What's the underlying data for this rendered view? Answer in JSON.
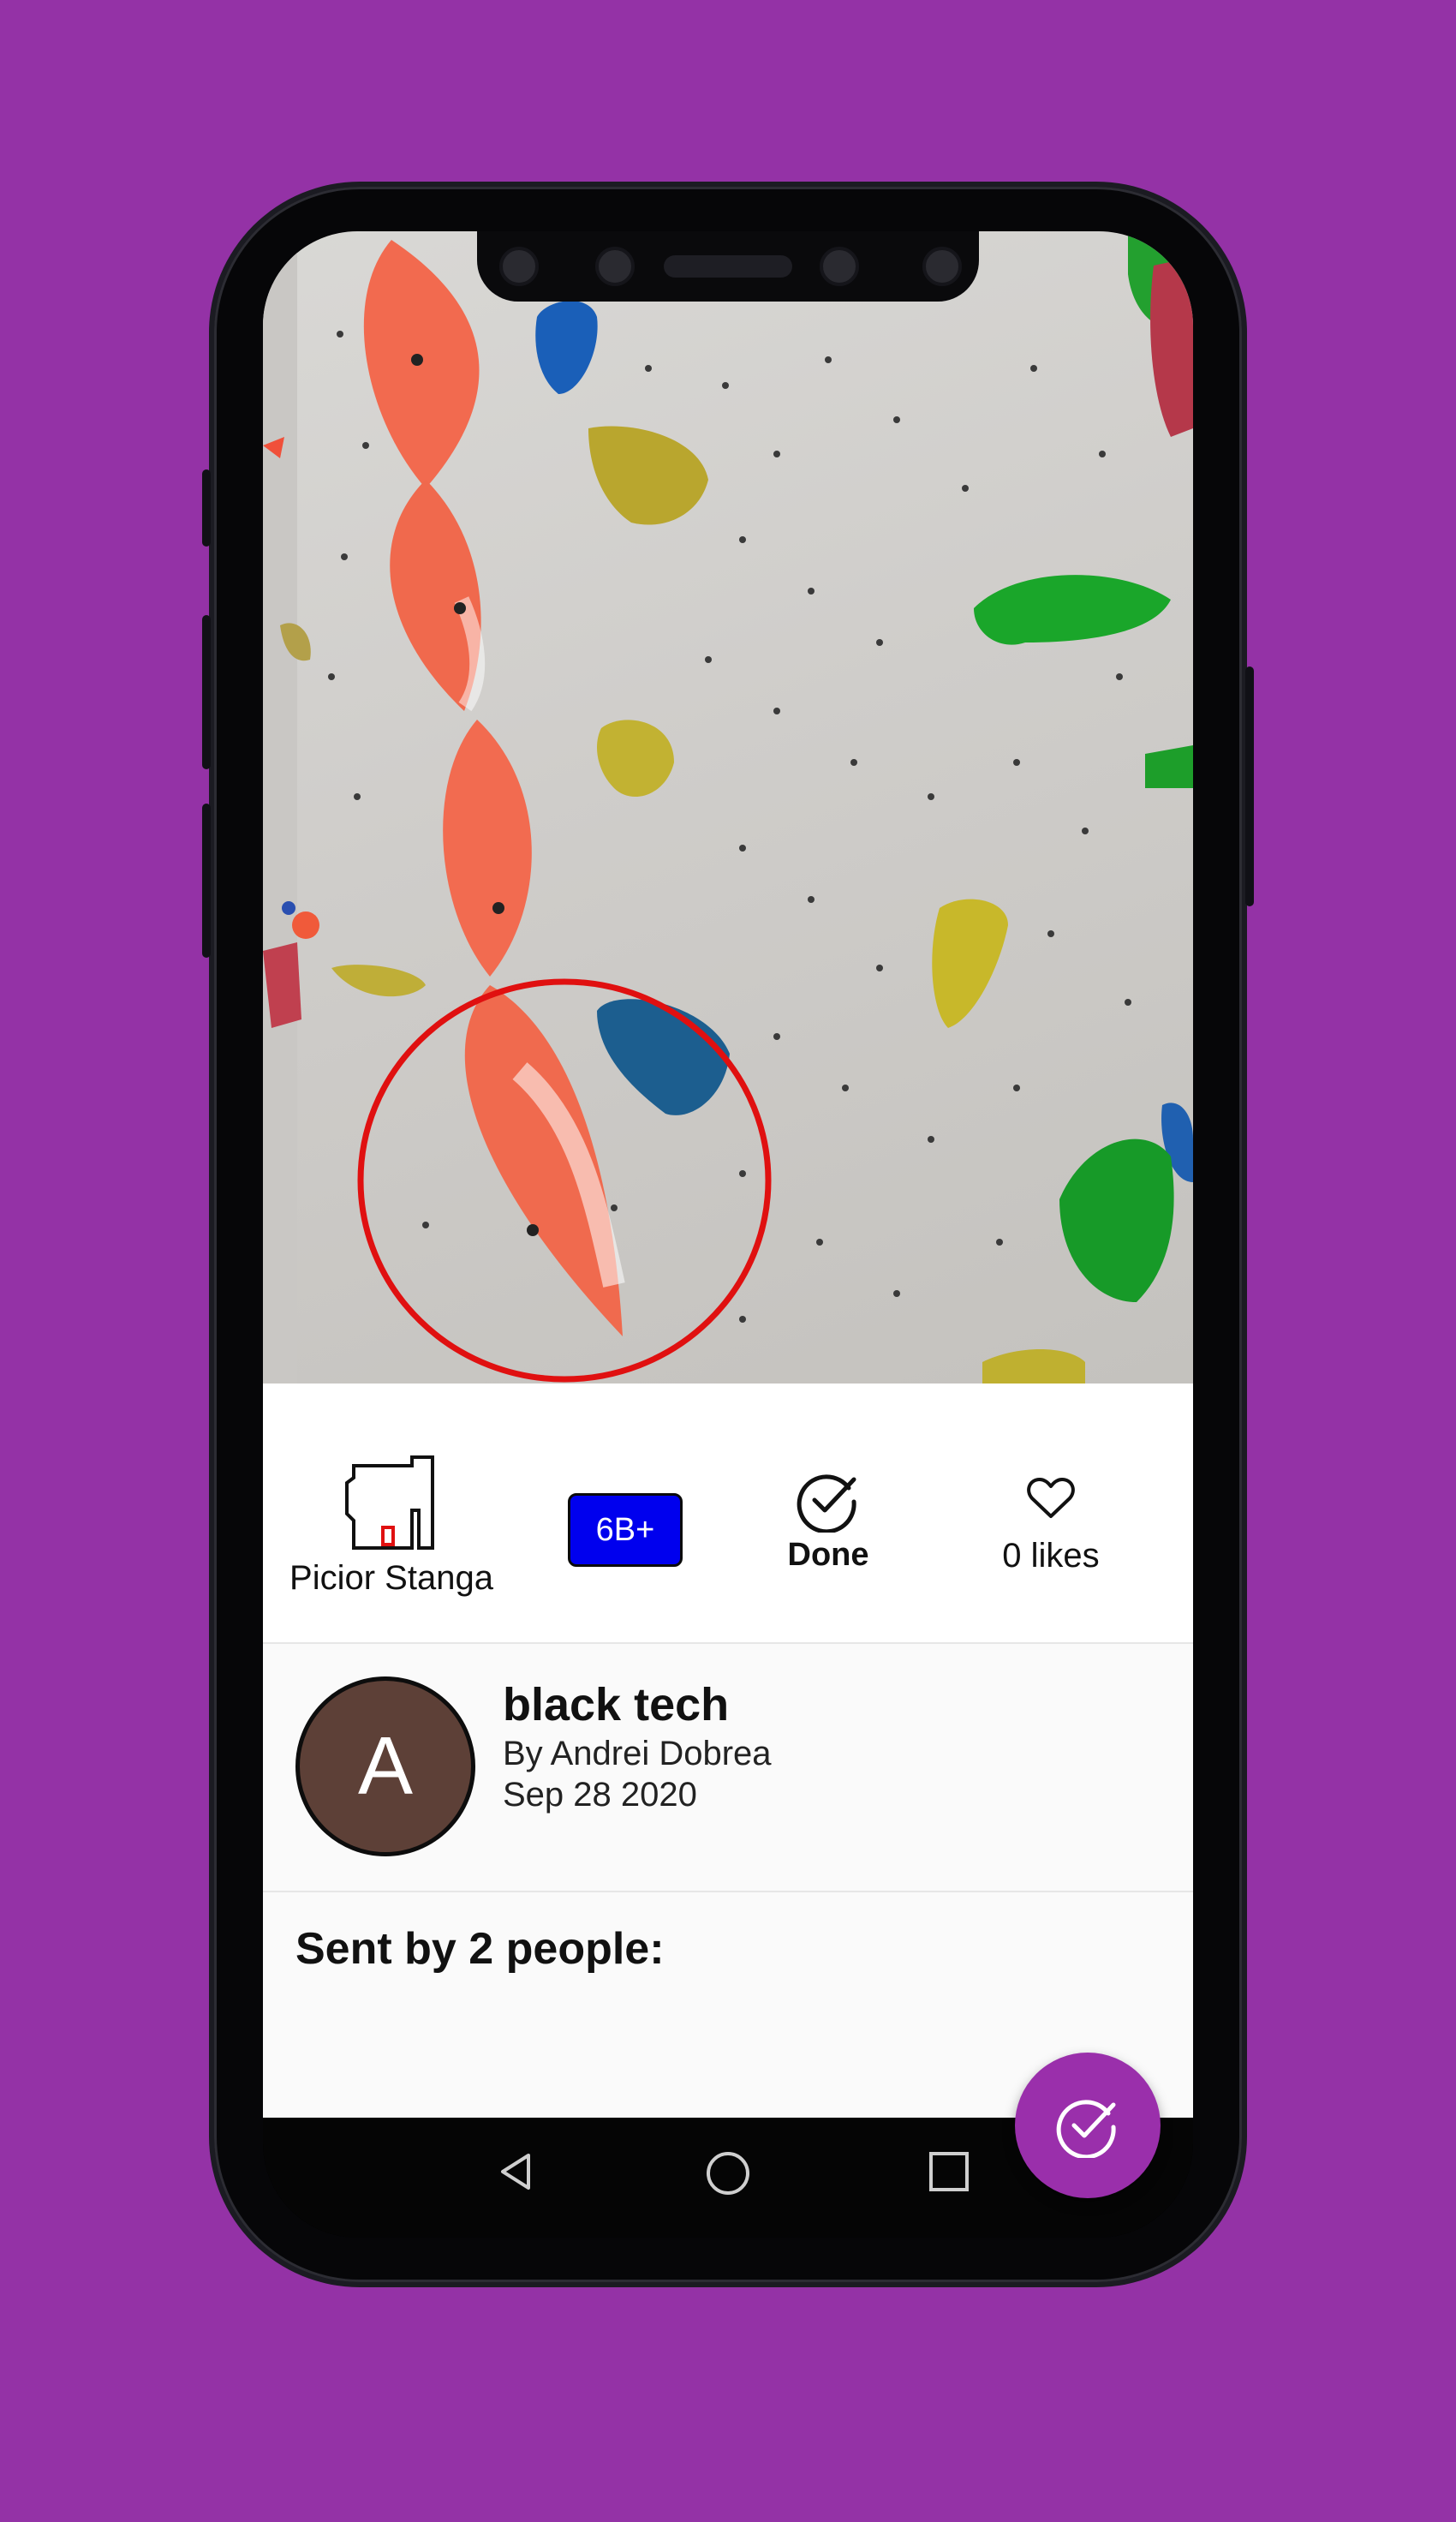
{
  "route": {
    "wall_label": "Picior Stanga",
    "grade": "6B+",
    "done_label": "Done",
    "likes_label": "0 likes",
    "name": "black tech",
    "author": "By Andrei Dobrea",
    "date": "Sep 28 2020",
    "avatar_letter": "A"
  },
  "sends": {
    "title": "Sent by 2 people:"
  },
  "colors": {
    "background": "#9432a6",
    "grade_badge": "#0000ee",
    "avatar": "#5d4037",
    "fab": "#9a2fab",
    "highlight_circle": "#e01010"
  },
  "icons": {
    "wall_map": "wall-map-icon",
    "done": "check-circle-icon",
    "likes": "heart-outline-icon",
    "fab": "check-circle-icon",
    "nav_back": "triangle-back-icon",
    "nav_home": "circle-home-icon",
    "nav_recents": "square-recents-icon"
  }
}
